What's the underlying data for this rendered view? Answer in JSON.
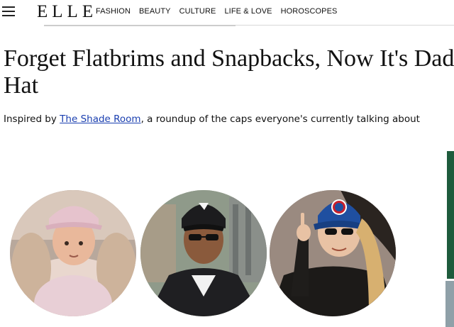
{
  "header": {
    "logo": "ELLE",
    "nav": [
      "FASHION",
      "BEAUTY",
      "CULTURE",
      "LIFE & LOVE",
      "HOROSCOPES"
    ]
  },
  "article": {
    "headline": "Forget Flatbrims and Snapbacks, Now It's Dad Hat",
    "dek_prefix": "Inspired by ",
    "dek_link": "The Shade Room",
    "dek_suffix": ", a roundup of the caps everyone's currently talking about"
  },
  "colors": {
    "link": "#1a3fb0",
    "cap_pink": "#e8c4cf",
    "cap_black": "#1c1c1e",
    "cap_blue": "#1f4fa0",
    "cap_red": "#c8202c"
  },
  "icons": [
    "hamburger-menu-icon",
    "cubs-logo"
  ]
}
